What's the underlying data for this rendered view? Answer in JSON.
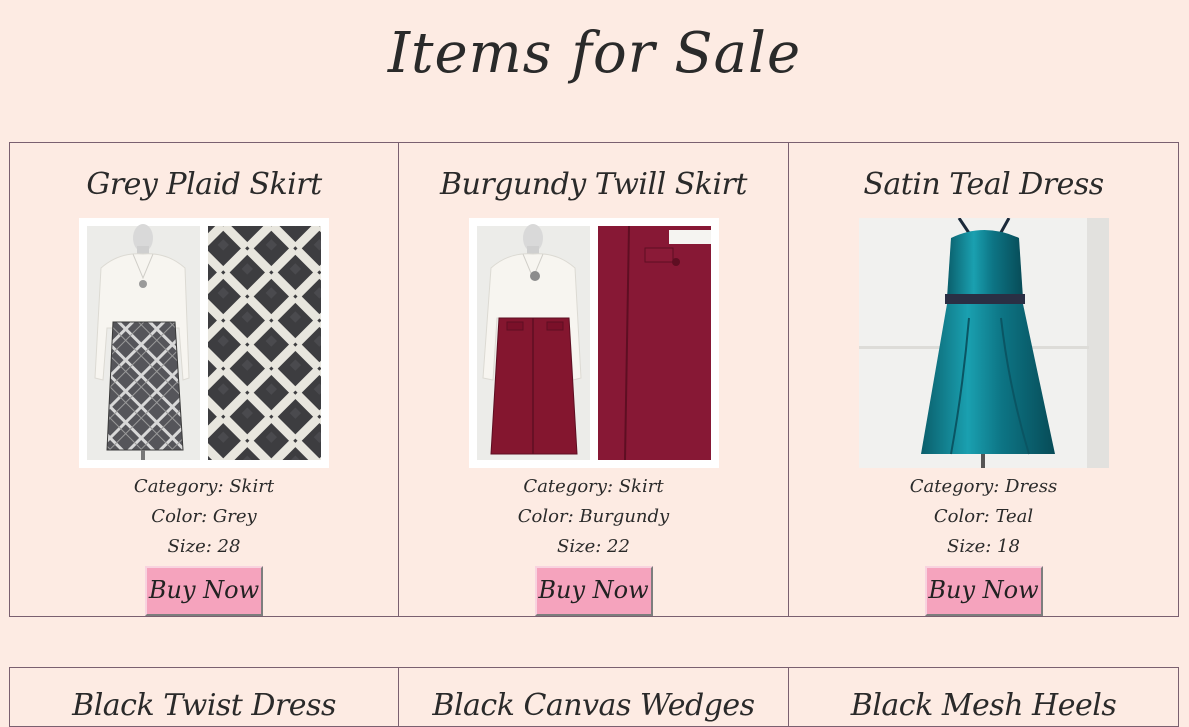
{
  "page": {
    "title": "Items for Sale"
  },
  "items": [
    {
      "title": "Grey Plaid Skirt",
      "category": "Category: Skirt",
      "color": "Color: Grey",
      "size": "Size: 28",
      "button": "Buy Now",
      "swatch": "#4a4a4f"
    },
    {
      "title": "Burgundy Twill Skirt",
      "category": "Category: Skirt",
      "color": "Color: Burgundy",
      "size": "Size: 22",
      "button": "Buy Now",
      "swatch": "#8a1c36"
    },
    {
      "title": "Satin Teal Dress",
      "category": "Category: Dress",
      "color": "Color: Teal",
      "size": "Size: 18",
      "button": "Buy Now",
      "swatch": "#0f7f8f"
    },
    {
      "title": "Black Twist Dress"
    },
    {
      "title": "Black Canvas Wedges"
    },
    {
      "title": "Black Mesh Heels"
    }
  ],
  "colors": {
    "background": "#fdebe3",
    "button": "#f5a3bd",
    "border": "#7a6070"
  }
}
